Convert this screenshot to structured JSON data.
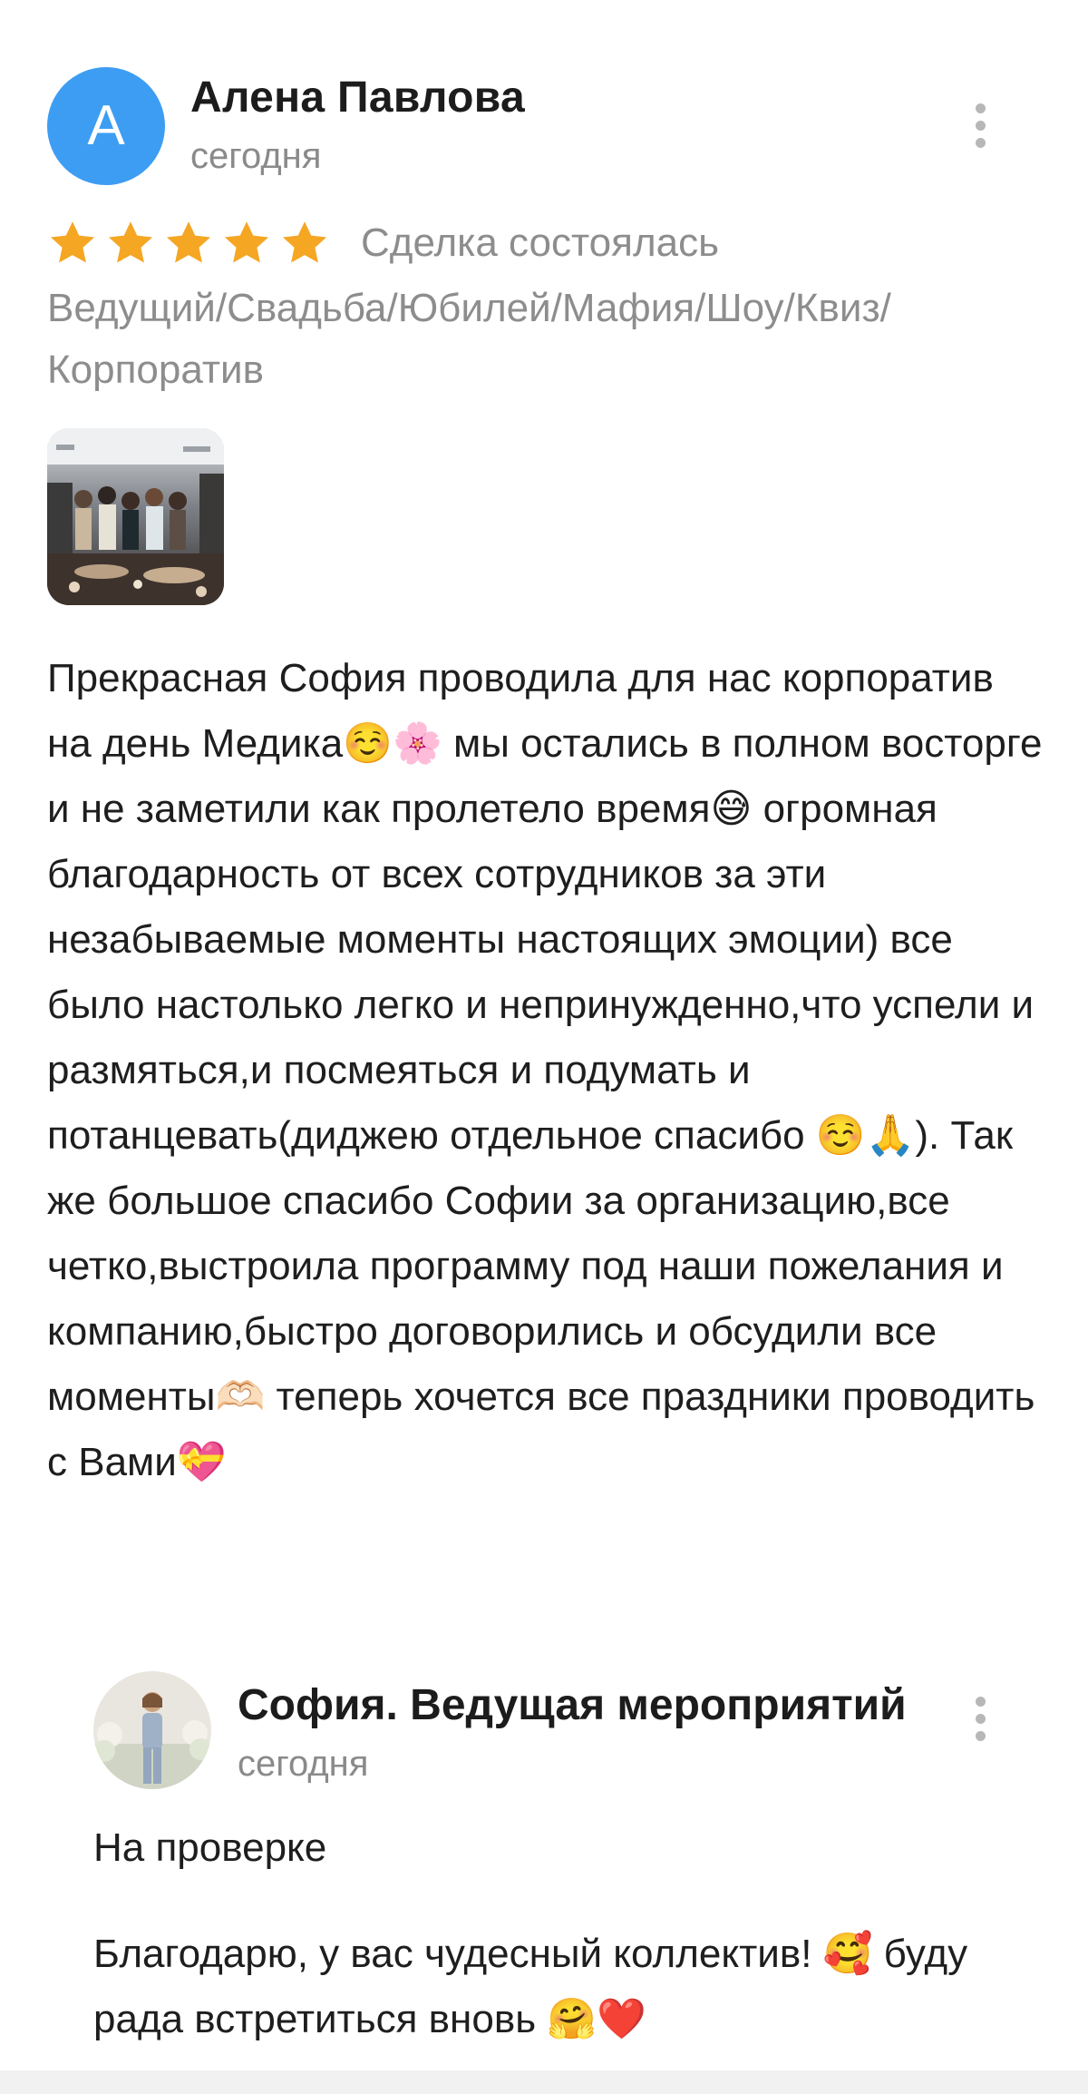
{
  "review": {
    "author": {
      "initial": "А",
      "name": "Алена Павлова",
      "date": "сегодня",
      "avatar_color": "#3d9df3"
    },
    "rating": {
      "stars": 5,
      "max": 5,
      "star_color": "#f5a623"
    },
    "deal_status": "Сделка состоялась",
    "category": "Ведущий/Свадьба/Юбилей/Мафия/Шоу/Квиз/ Корпоратив",
    "photo_icon": "event-photo-thumbnail",
    "text": "Прекрасная София проводила для нас корпоратив на день Медика☺️🌸 мы остались в полном восторге и не заметили как пролетело время😅 огромная благодарность от всех сотрудников за эти незабываемые моменты настоящих эмоции) все было настолько легко и непринужденно,что успели и размяться,и посмеяться и подумать и потанцевать(диджею отдельное спасибо ☺️🙏). Так же большое спасибо Софии за организацию,все четко,выстроила программу под наши пожелания и компанию,быстро договорились и обсудили все моменты🫶🏻 теперь хочется все праздники проводить с Вами💝",
    "menu_icon": "more-vertical-icon"
  },
  "reply": {
    "author": {
      "name": "София. Ведущая мероприятий",
      "date": "сегодня"
    },
    "status": "На проверке",
    "text": "Благодарю, у вас чудесный коллектив! 🥰 буду рада встретиться вновь 🤗❤️",
    "menu_icon": "more-vertical-icon"
  }
}
